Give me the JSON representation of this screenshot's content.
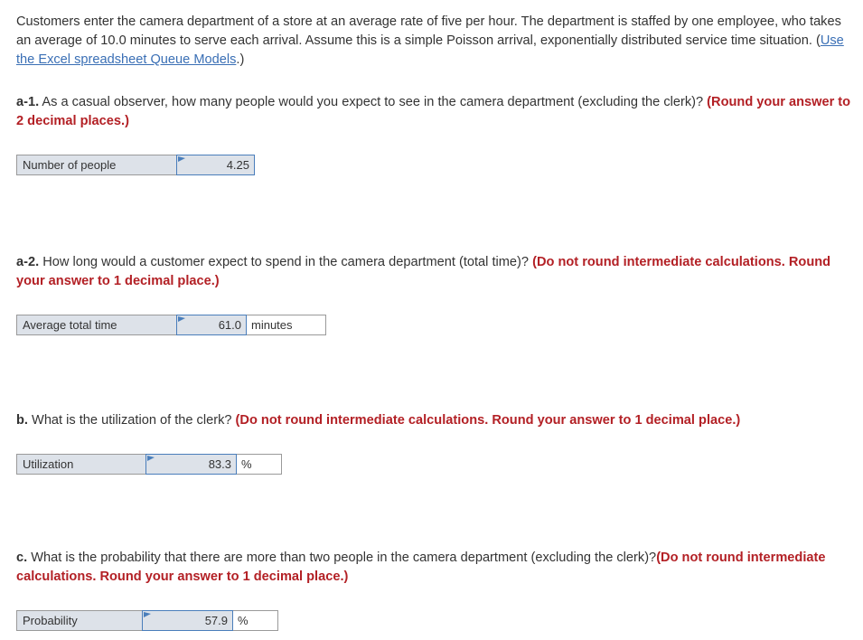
{
  "intro": {
    "text_before_link": "Customers enter the camera department of a store at an average rate of five per hour. The department is staffed by one employee, who takes an average of 10.0 minutes to serve each arrival. Assume this is a simple Poisson arrival, exponentially distributed service time situation. (",
    "link_text": "Use the Excel spreadsheet Queue Models",
    "text_after_link": ".)"
  },
  "questions": {
    "a1": {
      "label": "a-1.",
      "text": " As a casual observer, how many people would you expect to see in the camera department (excluding the clerk)? ",
      "note": "(Round your answer to 2 decimal places.)",
      "answer": {
        "row_label": "Number of people",
        "value": "4.25",
        "unit": ""
      }
    },
    "a2": {
      "label": "a-2.",
      "text": " How long would a customer expect to spend in the camera department (total time)? ",
      "note": "(Do not round intermediate calculations. Round your answer to 1 decimal place.)",
      "answer": {
        "row_label": "Average total time",
        "value": "61.0",
        "unit": "minutes"
      }
    },
    "b": {
      "label": "b.",
      "text": " What is the utilization of the clerk? ",
      "note": "(Do not round intermediate calculations. Round your answer to 1 decimal place.)",
      "answer": {
        "row_label": "Utilization",
        "value": "83.3",
        "unit": "%"
      }
    },
    "c": {
      "label": "c.",
      "text": " What is the probability that there are more than two people in the camera department (excluding the clerk)?",
      "note": "(Do not round intermediate calculations. Round your answer to 1 decimal place.)",
      "answer": {
        "row_label": "Probability",
        "value": "57.9",
        "unit": "%"
      }
    }
  },
  "colors": {
    "note_red": "#b32025",
    "link_blue": "#3a6fb5",
    "cell_fill": "#dde2e9",
    "cell_border_blue": "#4a7ebb",
    "cell_border_gray": "#9a9a9a",
    "body_text": "#333333"
  }
}
